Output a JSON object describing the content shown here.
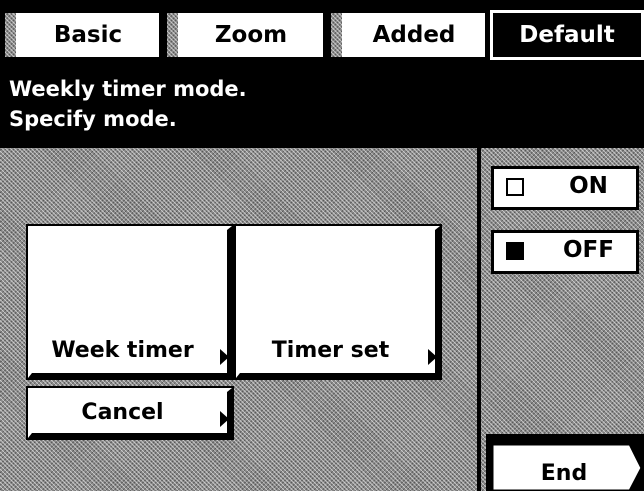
{
  "tabs": [
    {
      "label": "Basic",
      "active": false
    },
    {
      "label": "Zoom",
      "active": false
    },
    {
      "label": "Added",
      "active": false
    },
    {
      "label": "Default",
      "active": true
    }
  ],
  "message": {
    "line1": "Weekly timer mode.",
    "line2": "Specify mode."
  },
  "buttons": {
    "week_timer": "Week timer",
    "timer_set": "Timer set",
    "cancel": "Cancel",
    "end": "End"
  },
  "mode": {
    "on_label": "ON",
    "off_label": "OFF",
    "selected": "OFF"
  },
  "icons": {
    "button_arrow": "triangle-right-icon",
    "unchecked_box": "empty-checkbox-icon",
    "checked_box": "filled-checkbox-icon"
  }
}
